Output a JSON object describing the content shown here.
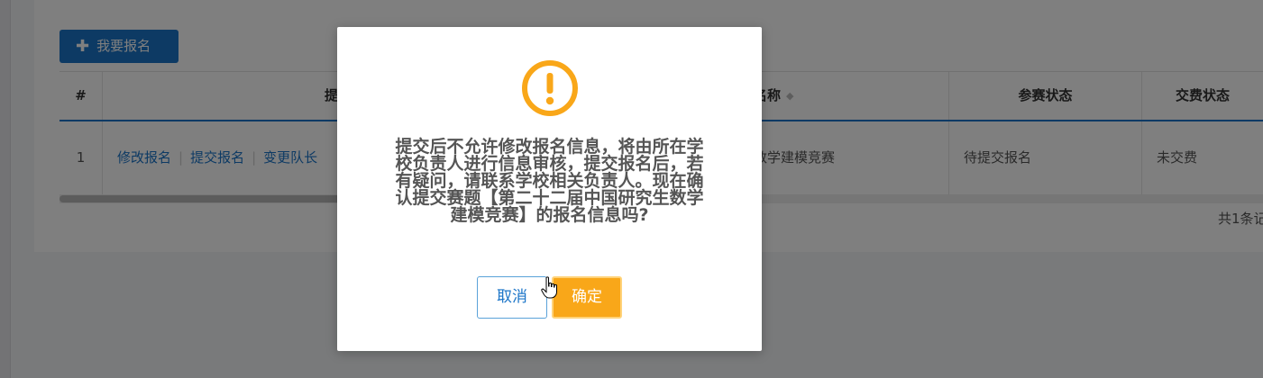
{
  "toolbar": {
    "add_label": "我要报名",
    "add_icon": "plus-icon"
  },
  "table": {
    "headers": [
      "#",
      "提",
      "名称",
      "参赛状态",
      "交费状态"
    ],
    "row": {
      "index": "1",
      "actions": [
        "修改报名",
        "提交报名",
        "变更队长"
      ],
      "contest_name": "数学建模竞赛",
      "participation_status": "待提交报名",
      "payment_status": "未交费"
    }
  },
  "pager": {
    "total": "共1条记"
  },
  "dialog": {
    "icon": "warning-icon",
    "message_lines": [
      "提交后不允许修改报名信息，将由所在学",
      "校负责人进行信息审核，提交报名后，若",
      "有疑问，请联系学校相关负责人。现在确",
      "认提交赛题【第二十二届中国研究生数学",
      "建模竞赛】的报名信息吗?"
    ],
    "cancel_label": "取消",
    "confirm_label": "确定"
  },
  "colors": {
    "primary": "#1a74c8",
    "warning": "#f9a719",
    "overlay": "rgba(0,0,0,0.5)"
  }
}
